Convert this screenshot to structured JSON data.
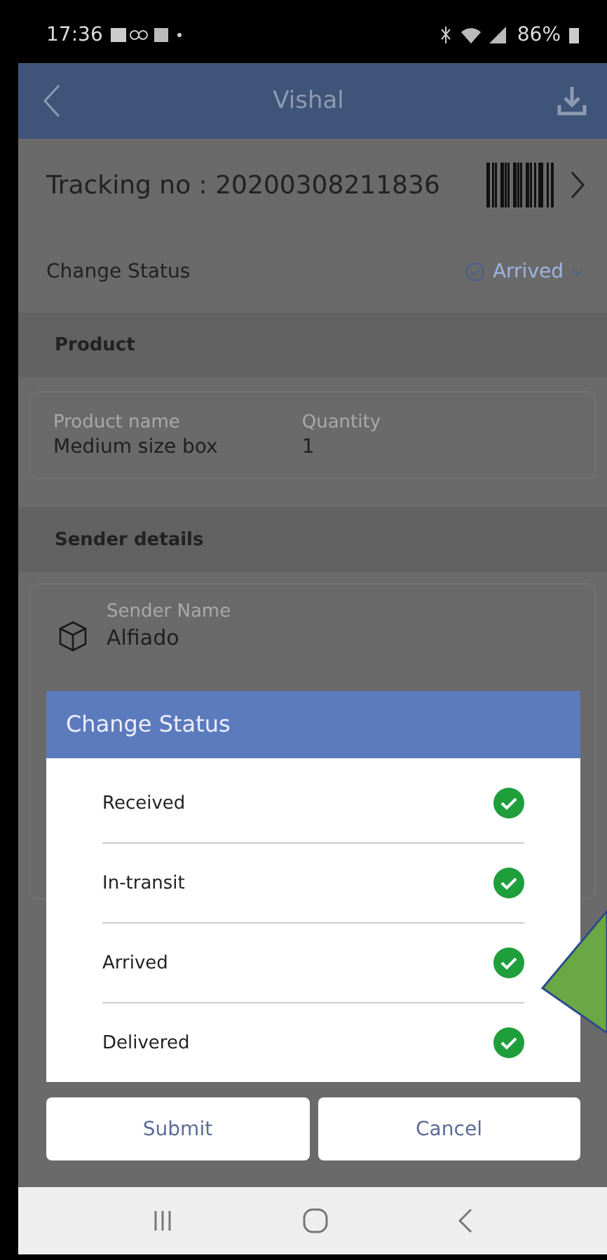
{
  "status_bar": {
    "time": "17:36",
    "battery": "86%"
  },
  "app_bar": {
    "title": "Vishal"
  },
  "tracking": {
    "label": "Tracking no : 20200308211836"
  },
  "change_status": {
    "label": "Change Status",
    "value": "Arrived"
  },
  "product": {
    "header": "Product",
    "name_label": "Product name",
    "name": "Medium size box",
    "quantity_label": "Quantity",
    "quantity": "1"
  },
  "sender": {
    "header": "Sender details",
    "name_label": "Sender Name",
    "name": "Alfiado"
  },
  "dialog": {
    "title": "Change Status",
    "options": [
      {
        "label": "Received",
        "checked": true
      },
      {
        "label": "In-transit",
        "checked": true
      },
      {
        "label": "Arrived",
        "checked": true
      },
      {
        "label": "Delivered",
        "checked": true
      }
    ],
    "buttons": [
      {
        "label": "Submit"
      },
      {
        "label": "Cancel"
      }
    ]
  }
}
